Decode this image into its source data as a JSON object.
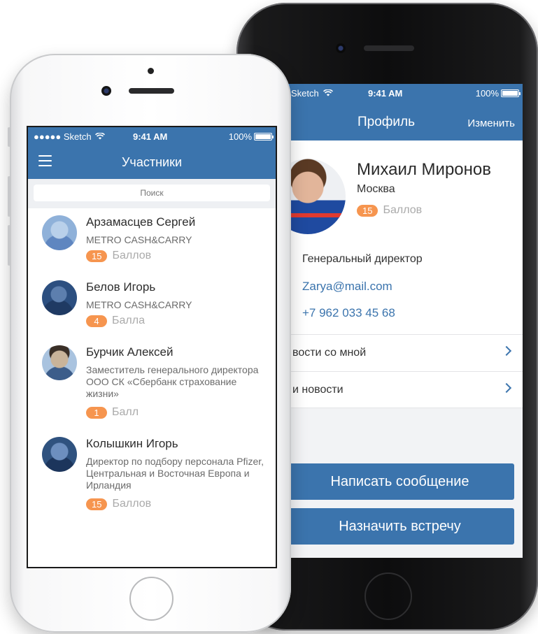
{
  "status_bar": {
    "carrier_front": "●●●●● Sketch",
    "carrier_back": "Sketch",
    "time": "9:41 AM",
    "battery": "100%"
  },
  "members_screen": {
    "title": "Участники",
    "search_placeholder": "Поиск",
    "members": [
      {
        "name": "Арзамасцев Сергей",
        "org": "METRO CASH&CARRY",
        "score": "15",
        "score_label": "Баллов"
      },
      {
        "name": "Белов Игорь",
        "org": "METRO CASH&CARRY",
        "score": "4",
        "score_label": "Балла"
      },
      {
        "name": "Бурчик Алексей",
        "org": "Заместитель генерального директора ООО СК «Сбербанк страхование жизни»",
        "score": "1",
        "score_label": "Балл"
      },
      {
        "name": "Колышкин Игорь",
        "org": "Директор по подбору персонала Pfizer, Центральная и Восточная Европа и Ирландия",
        "score": "15",
        "score_label": "Баллов"
      }
    ]
  },
  "profile_screen": {
    "title": "Профиль",
    "edit_label": "Изменить",
    "name": "Михаил Миронов",
    "city": "Москва",
    "score": "15",
    "score_label": "Баллов",
    "role": "Генеральный директор",
    "email": "Zarya@mail.com",
    "phone": "+7 962 033 45 68",
    "links": [
      {
        "label": "вости со мной"
      },
      {
        "label": "и новости"
      }
    ],
    "buttons": {
      "message": "Написать сообщение",
      "meeting": "Назначить встречу"
    }
  },
  "colors": {
    "header_blue": "#3b74ad",
    "badge_orange": "#f6954f"
  }
}
